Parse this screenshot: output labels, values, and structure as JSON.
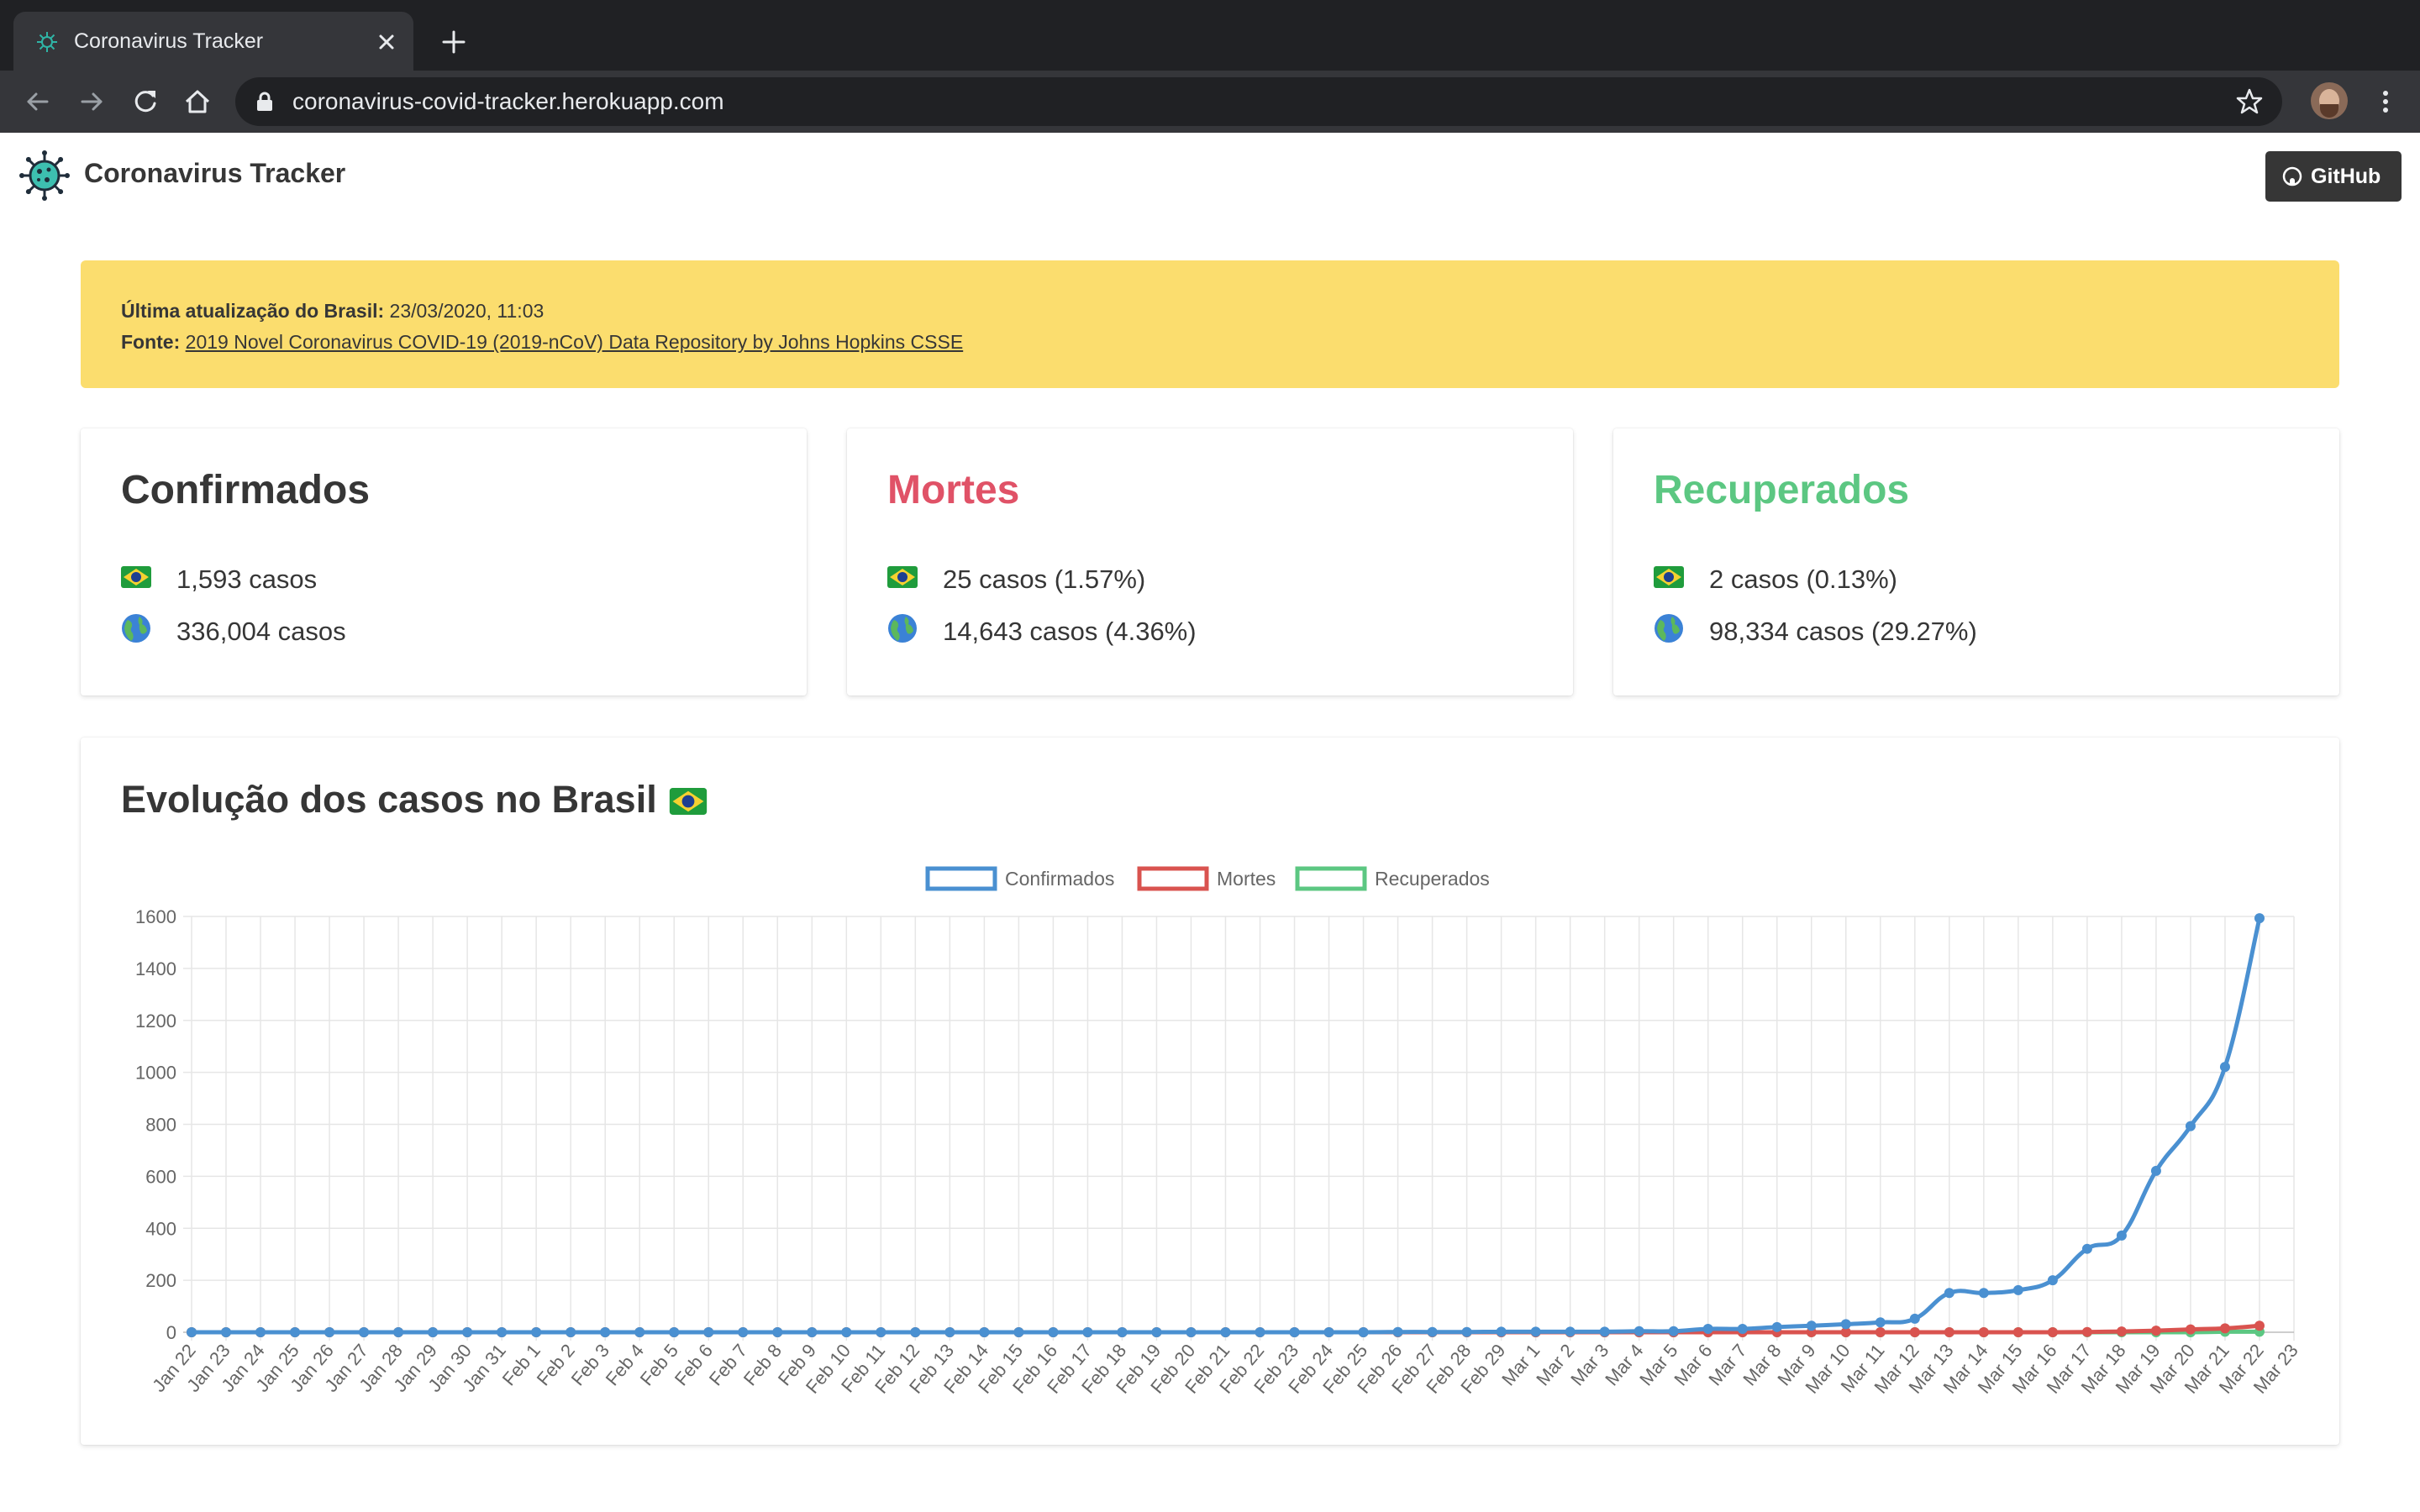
{
  "browser": {
    "tab_title": "Coronavirus Tracker",
    "url": "coronavirus-covid-tracker.herokuapp.com"
  },
  "navbar": {
    "brand": "Coronavirus Tracker",
    "github_label": "GitHub"
  },
  "notice": {
    "update_label": "Última atualização do Brasil:",
    "update_value": "23/03/2020, 11:03",
    "source_label": "Fonte:",
    "source_link": "2019 Novel Coronavirus COVID-19 (2019-nCoV) Data Repository by Johns Hopkins CSSE"
  },
  "cards": [
    {
      "title": "Confirmados",
      "color": "#363636",
      "brazil": "1,593 casos",
      "world": "336,004 casos"
    },
    {
      "title": "Mortes",
      "color": "#e05267",
      "brazil": "25 casos (1.57%)",
      "world": "14,643 casos (4.36%)"
    },
    {
      "title": "Recuperados",
      "color": "#5cc782",
      "brazil": "2 casos (0.13%)",
      "world": "98,334 casos (29.27%)"
    }
  ],
  "chart_section": {
    "title": "Evolução dos casos no Brasil"
  },
  "chart_data": {
    "type": "line",
    "title": "",
    "xlabel": "",
    "ylabel": "",
    "ylim": [
      0,
      1600
    ],
    "yticks": [
      0,
      200,
      400,
      600,
      800,
      1000,
      1200,
      1400,
      1600
    ],
    "grid": true,
    "legend_position": "top",
    "categories": [
      "Jan 22",
      "Jan 23",
      "Jan 24",
      "Jan 25",
      "Jan 26",
      "Jan 27",
      "Jan 28",
      "Jan 29",
      "Jan 30",
      "Jan 31",
      "Feb 1",
      "Feb 2",
      "Feb 3",
      "Feb 4",
      "Feb 5",
      "Feb 6",
      "Feb 7",
      "Feb 8",
      "Feb 9",
      "Feb 10",
      "Feb 11",
      "Feb 12",
      "Feb 13",
      "Feb 14",
      "Feb 15",
      "Feb 16",
      "Feb 17",
      "Feb 18",
      "Feb 19",
      "Feb 20",
      "Feb 21",
      "Feb 22",
      "Feb 23",
      "Feb 24",
      "Feb 25",
      "Feb 26",
      "Feb 27",
      "Feb 28",
      "Feb 29",
      "Mar 1",
      "Mar 2",
      "Mar 3",
      "Mar 4",
      "Mar 5",
      "Mar 6",
      "Mar 7",
      "Mar 8",
      "Mar 9",
      "Mar 10",
      "Mar 11",
      "Mar 12",
      "Mar 13",
      "Mar 14",
      "Mar 15",
      "Mar 16",
      "Mar 17",
      "Mar 18",
      "Mar 19",
      "Mar 20",
      "Mar 21",
      "Mar 22",
      "Mar 23"
    ],
    "series": [
      {
        "name": "Confirmados",
        "color": "#4a90d1",
        "values": [
          0,
          0,
          0,
          0,
          0,
          0,
          0,
          0,
          0,
          0,
          0,
          0,
          0,
          0,
          0,
          0,
          0,
          0,
          0,
          0,
          0,
          0,
          0,
          0,
          0,
          0,
          0,
          0,
          0,
          0,
          0,
          0,
          0,
          0,
          0,
          1,
          1,
          1,
          2,
          2,
          2,
          2,
          4,
          4,
          13,
          13,
          20,
          25,
          31,
          38,
          52,
          151,
          151,
          162,
          200,
          321,
          372,
          621,
          793,
          1021,
          1593
        ]
      },
      {
        "name": "Mortes",
        "color": "#d9534f",
        "values": [
          0,
          0,
          0,
          0,
          0,
          0,
          0,
          0,
          0,
          0,
          0,
          0,
          0,
          0,
          0,
          0,
          0,
          0,
          0,
          0,
          0,
          0,
          0,
          0,
          0,
          0,
          0,
          0,
          0,
          0,
          0,
          0,
          0,
          0,
          0,
          0,
          0,
          0,
          0,
          0,
          0,
          0,
          0,
          0,
          0,
          0,
          0,
          0,
          0,
          0,
          0,
          0,
          0,
          0,
          0,
          1,
          3,
          6,
          11,
          15,
          25
        ]
      },
      {
        "name": "Recuperados",
        "color": "#5cc782",
        "values": [
          0,
          0,
          0,
          0,
          0,
          0,
          0,
          0,
          0,
          0,
          0,
          0,
          0,
          0,
          0,
          0,
          0,
          0,
          0,
          0,
          0,
          0,
          0,
          0,
          0,
          0,
          0,
          0,
          0,
          0,
          0,
          0,
          0,
          0,
          0,
          0,
          0,
          0,
          0,
          0,
          0,
          0,
          0,
          0,
          0,
          0,
          0,
          0,
          0,
          0,
          0,
          0,
          0,
          0,
          0,
          0,
          0,
          0,
          0,
          2,
          2
        ]
      }
    ]
  }
}
